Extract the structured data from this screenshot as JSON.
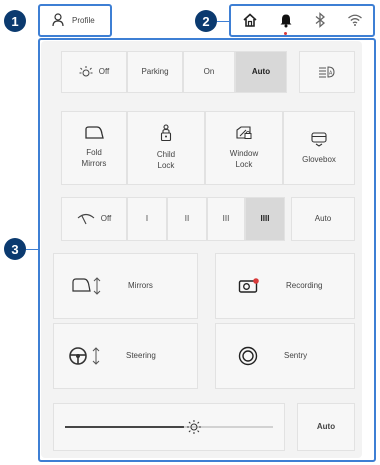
{
  "callouts": [
    "1",
    "2",
    "3"
  ],
  "topbar": {
    "profile_label": "Profile",
    "icons": [
      "home-icon",
      "bell-icon",
      "bluetooth-icon",
      "wifi-icon"
    ]
  },
  "lights": {
    "off": "Off",
    "parking": "Parking",
    "on": "On",
    "auto": "Auto",
    "selected": "Auto"
  },
  "controls": {
    "fold_mirrors": "Fold\nMirrors",
    "child_lock": "Child\nLock",
    "window_lock": "Window\nLock",
    "glovebox": "Glovebox"
  },
  "wipers": {
    "off": "Off",
    "levels": [
      "I",
      "II",
      "III",
      "IIII"
    ],
    "selected": "IIII",
    "auto": "Auto"
  },
  "features": {
    "mirrors": "Mirrors",
    "steering": "Steering",
    "recording": "Recording",
    "sentry": "Sentry"
  },
  "brightness": {
    "level": 0.62,
    "auto": "Auto"
  },
  "colors": {
    "callout": "#0b3a6f",
    "highlight": "#3e7fd4",
    "recording_dot": "#d83a3a"
  }
}
